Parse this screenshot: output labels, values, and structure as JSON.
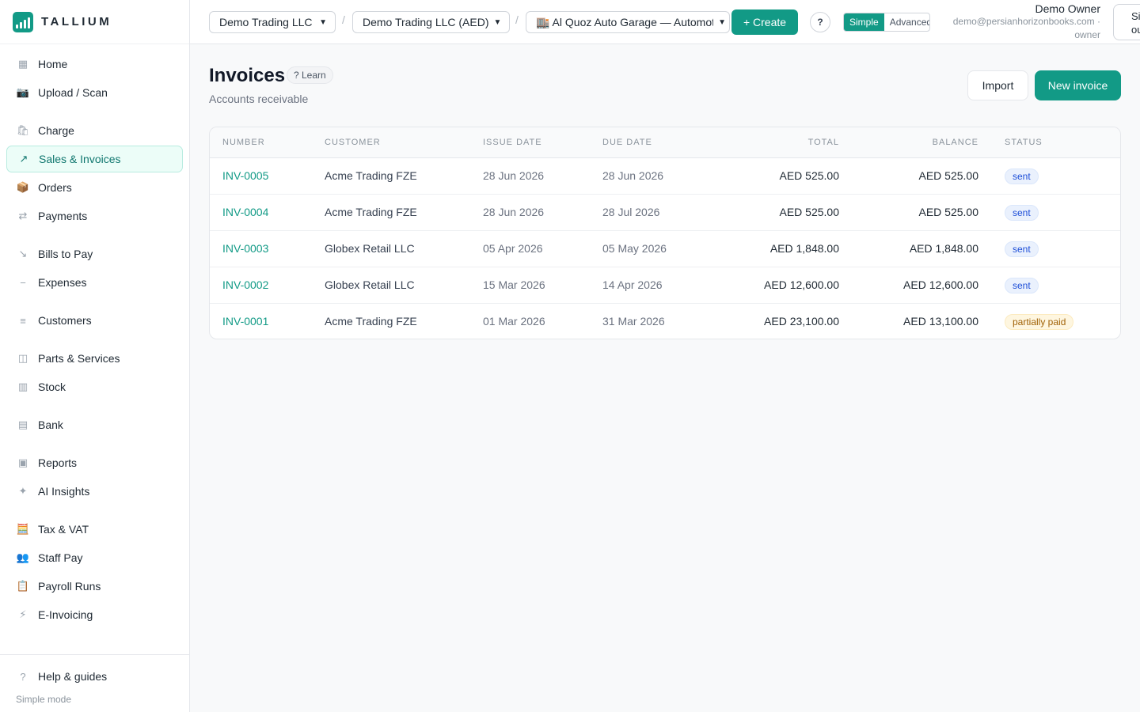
{
  "brand": {
    "name": "TALLIUM"
  },
  "sidebar": {
    "items": [
      {
        "label": "Home",
        "icon": "grid-icon",
        "glyph": "▦"
      },
      {
        "label": "Upload / Scan",
        "icon": "camera-icon",
        "glyph": "📷"
      },
      {
        "label": "Charge",
        "icon": "shopping-bag-icon",
        "glyph": "🛍"
      },
      {
        "label": "Sales & Invoices",
        "icon": "arrow-up-right-icon",
        "glyph": "↗",
        "active": true
      },
      {
        "label": "Orders",
        "icon": "package-icon",
        "glyph": "📦"
      },
      {
        "label": "Payments",
        "icon": "transfer-icon",
        "glyph": "⇄"
      },
      {
        "label": "Bills to Pay",
        "icon": "arrow-down-right-icon",
        "glyph": "↘"
      },
      {
        "label": "Expenses",
        "icon": "minus-icon",
        "glyph": "−"
      },
      {
        "label": "Customers",
        "icon": "list-icon",
        "glyph": "≡"
      },
      {
        "label": "Parts & Services",
        "icon": "box-icon",
        "glyph": "◫"
      },
      {
        "label": "Stock",
        "icon": "stock-icon",
        "glyph": "▥"
      },
      {
        "label": "Bank",
        "icon": "bank-icon",
        "glyph": "▤"
      },
      {
        "label": "Reports",
        "icon": "report-icon",
        "glyph": "▣"
      },
      {
        "label": "AI Insights",
        "icon": "sparkle-icon",
        "glyph": "✦"
      },
      {
        "label": "Tax & VAT",
        "icon": "abacus-icon",
        "glyph": "🧮"
      },
      {
        "label": "Staff Pay",
        "icon": "people-icon",
        "glyph": "👥"
      },
      {
        "label": "Payroll Runs",
        "icon": "clipboard-icon",
        "glyph": "📋"
      },
      {
        "label": "E-Invoicing",
        "icon": "lightning-icon",
        "glyph": "⚡"
      }
    ],
    "help": {
      "label": "Help & guides",
      "glyph": "?"
    },
    "mode": "Simple mode"
  },
  "topbar": {
    "company": "Demo Trading LLC",
    "ledger": "Demo Trading LLC (AED)",
    "branch": "🏬 Al Quoz Auto Garage — Automotive",
    "create": "+ Create",
    "help": "?",
    "mode_simple": "Simple",
    "mode_advanced": "Advanced",
    "user_name": "Demo Owner",
    "user_email": "demo@persianhorizonbooks.com ·",
    "user_role": "owner",
    "signout": "Sign out"
  },
  "page": {
    "title": "Invoices",
    "learn": "? Learn",
    "subtitle": "Accounts receivable",
    "import": "Import",
    "new_invoice": "New invoice"
  },
  "table": {
    "headers": [
      "NUMBER",
      "CUSTOMER",
      "ISSUE DATE",
      "DUE DATE",
      "TOTAL",
      "BALANCE",
      "STATUS"
    ],
    "rows": [
      {
        "number": "INV-0005",
        "customer": "Acme Trading FZE",
        "issue": "28 Jun 2026",
        "due": "28 Jun 2026",
        "total": "AED 525.00",
        "balance": "AED 525.00",
        "status": "sent"
      },
      {
        "number": "INV-0004",
        "customer": "Acme Trading FZE",
        "issue": "28 Jun 2026",
        "due": "28 Jul 2026",
        "total": "AED 525.00",
        "balance": "AED 525.00",
        "status": "sent"
      },
      {
        "number": "INV-0003",
        "customer": "Globex Retail LLC",
        "issue": "05 Apr 2026",
        "due": "05 May 2026",
        "total": "AED 1,848.00",
        "balance": "AED 1,848.00",
        "status": "sent"
      },
      {
        "number": "INV-0002",
        "customer": "Globex Retail LLC",
        "issue": "15 Mar 2026",
        "due": "14 Apr 2026",
        "total": "AED 12,600.00",
        "balance": "AED 12,600.00",
        "status": "sent"
      },
      {
        "number": "INV-0001",
        "customer": "Acme Trading FZE",
        "issue": "01 Mar 2026",
        "due": "31 Mar 2026",
        "total": "AED 23,100.00",
        "balance": "AED 13,100.00",
        "status": "partially paid"
      }
    ]
  },
  "colors": {
    "accent": "#129a86",
    "sent_badge": "#eaf1fd",
    "partial_badge": "#fef6e0"
  }
}
